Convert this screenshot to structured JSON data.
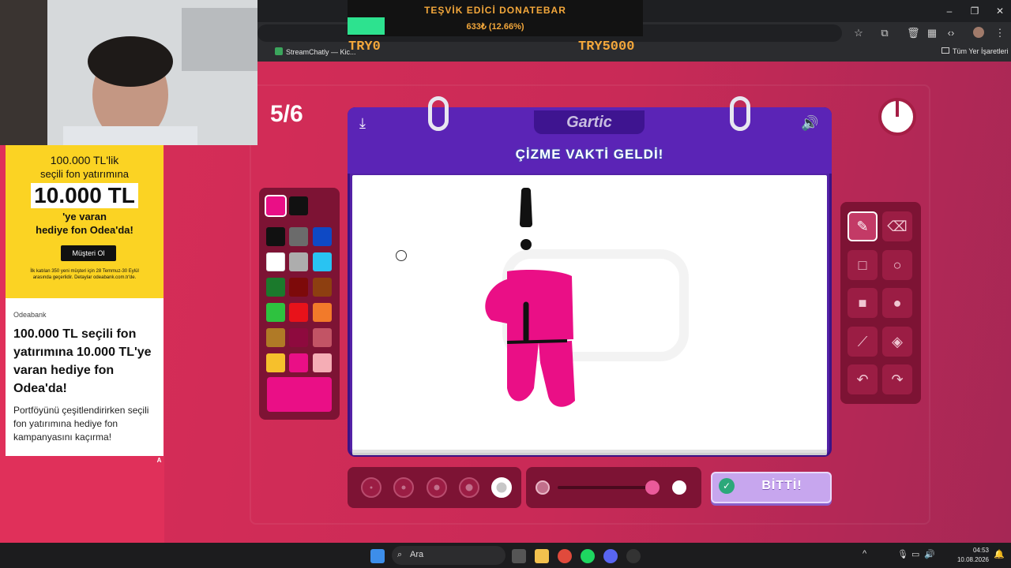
{
  "donation": {
    "title": "TEŞVİK EDİCİ DONATEBAR",
    "amount_text": "633₺ (12.66%)",
    "progress_fraction": 0.1266,
    "min_label": "TRY0",
    "max_label": "TRY5000"
  },
  "browser": {
    "bookmarks": [
      {
        "label": "StreamChatly — Kic..."
      },
      {
        "label": "Tüm Yer İşaretleri"
      }
    ]
  },
  "game": {
    "round": "5/6",
    "logo": "Gartic",
    "headline": "ÇİZME VAKTİ GELDİ!",
    "done_button": "BİTTİ!",
    "selected_color": "#ea0f86",
    "palette_colors": [
      "#ea0f86",
      "#111111",
      "#111111",
      "#6b6b6b",
      "#0e49c5",
      "#ffffff",
      "#adadad",
      "#29c3f2",
      "#1b7a2c",
      "#7d0a0a",
      "#8d3f10",
      "#2ec23f",
      "#e8121a",
      "#f27a2a",
      "#b07a26",
      "#8e0a3e",
      "#c25465",
      "#f6c02c",
      "#ea0f86",
      "#f5adb5"
    ],
    "tools": [
      "pencil-icon",
      "eraser-icon",
      "rectangle-icon",
      "circle-icon",
      "filled-rectangle-icon",
      "filled-circle-icon",
      "line-icon",
      "fill-bucket-icon",
      "undo-icon",
      "redo-icon"
    ],
    "brush_size_selected_index": 4,
    "opacity_fraction": 1.0
  },
  "ad": {
    "headline1": "100.000 TL'lik",
    "headline2": "seçili fon yatırımına",
    "headline_big": "10.000 TL",
    "headline3": "'ye varan",
    "headline4": "hediye fon Odea'da!",
    "cta": "Müşteri Ol",
    "fine_print": "İlk katılan 350 yeni müşteri için 28 Temmuz-30 Eylül arasında geçerlidir. Detaylar odeabank.com.tr'de.",
    "advertiser": "Odeabank",
    "title": "100.000 TL seçili fon yatırımına 10.000 TL'ye varan hediye fon Odea'da!",
    "body": "Portföyünü çeşitlendirirken seçili fon yatırımına hediye fon kampanyasını kaçırma!",
    "marker": "A"
  },
  "taskbar": {
    "search_placeholder": "Ara",
    "time": "04:53",
    "date": "10.08.2026"
  }
}
